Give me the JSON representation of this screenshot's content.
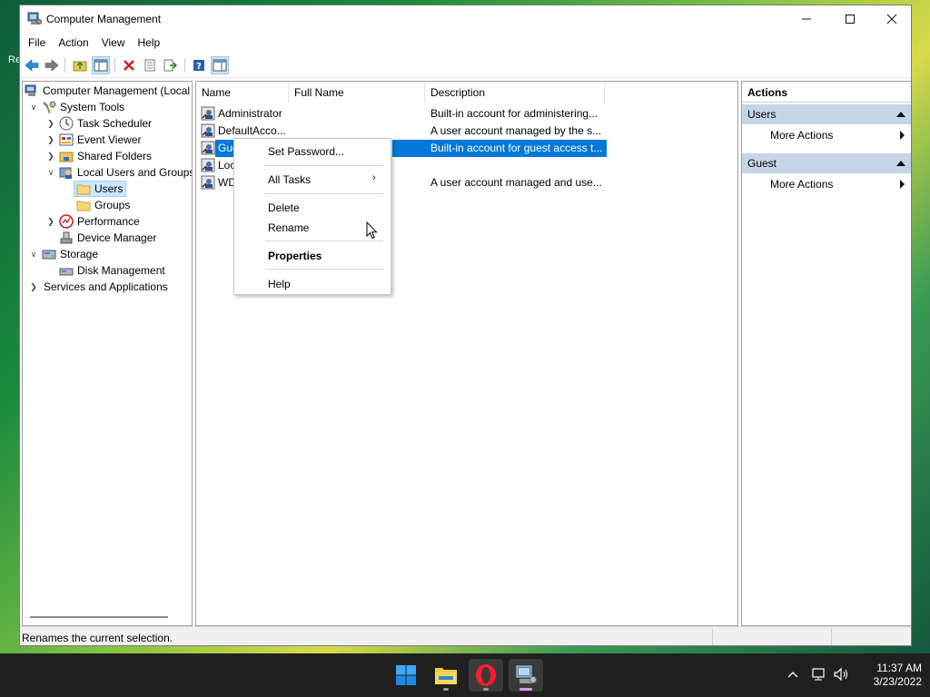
{
  "window": {
    "title": "Computer Management",
    "menu": [
      "File",
      "Action",
      "View",
      "Help"
    ]
  },
  "tree": {
    "root": "Computer Management (Local",
    "system_tools": "System Tools",
    "task_scheduler": "Task Scheduler",
    "event_viewer": "Event Viewer",
    "shared_folders": "Shared Folders",
    "local_users": "Local Users and Groups",
    "users": "Users",
    "groups": "Groups",
    "performance": "Performance",
    "device_manager": "Device Manager",
    "storage": "Storage",
    "disk_management": "Disk Management",
    "services": "Services and Applications"
  },
  "list": {
    "columns": [
      "Name",
      "Full Name",
      "Description"
    ],
    "rows": [
      {
        "name": "Administrator",
        "full": "",
        "desc": "Built-in account for administering..."
      },
      {
        "name": "DefaultAcco...",
        "full": "",
        "desc": "A user account managed by the s..."
      },
      {
        "name": "Gue",
        "full": "",
        "desc": "Built-in account for guest access t..."
      },
      {
        "name": "Loc",
        "full": "",
        "desc": ""
      },
      {
        "name": "WD",
        "full": "",
        "desc": "A user account managed and use..."
      }
    ]
  },
  "context_menu": {
    "set_password": "Set Password...",
    "all_tasks": "All Tasks",
    "delete": "Delete",
    "rename": "Rename",
    "properties": "Properties",
    "help": "Help"
  },
  "actions": {
    "header": "Actions",
    "section1": "Users",
    "section2": "Guest",
    "more1": "More Actions",
    "more2": "More Actions"
  },
  "status": "Renames the current selection.",
  "desktop_text": "Re",
  "clock": {
    "time": "11:37 AM",
    "date": "3/23/2022"
  },
  "colors": {
    "selection": "#0078d7",
    "action_header": "#c5d5e7",
    "taskbar": "#202020"
  }
}
